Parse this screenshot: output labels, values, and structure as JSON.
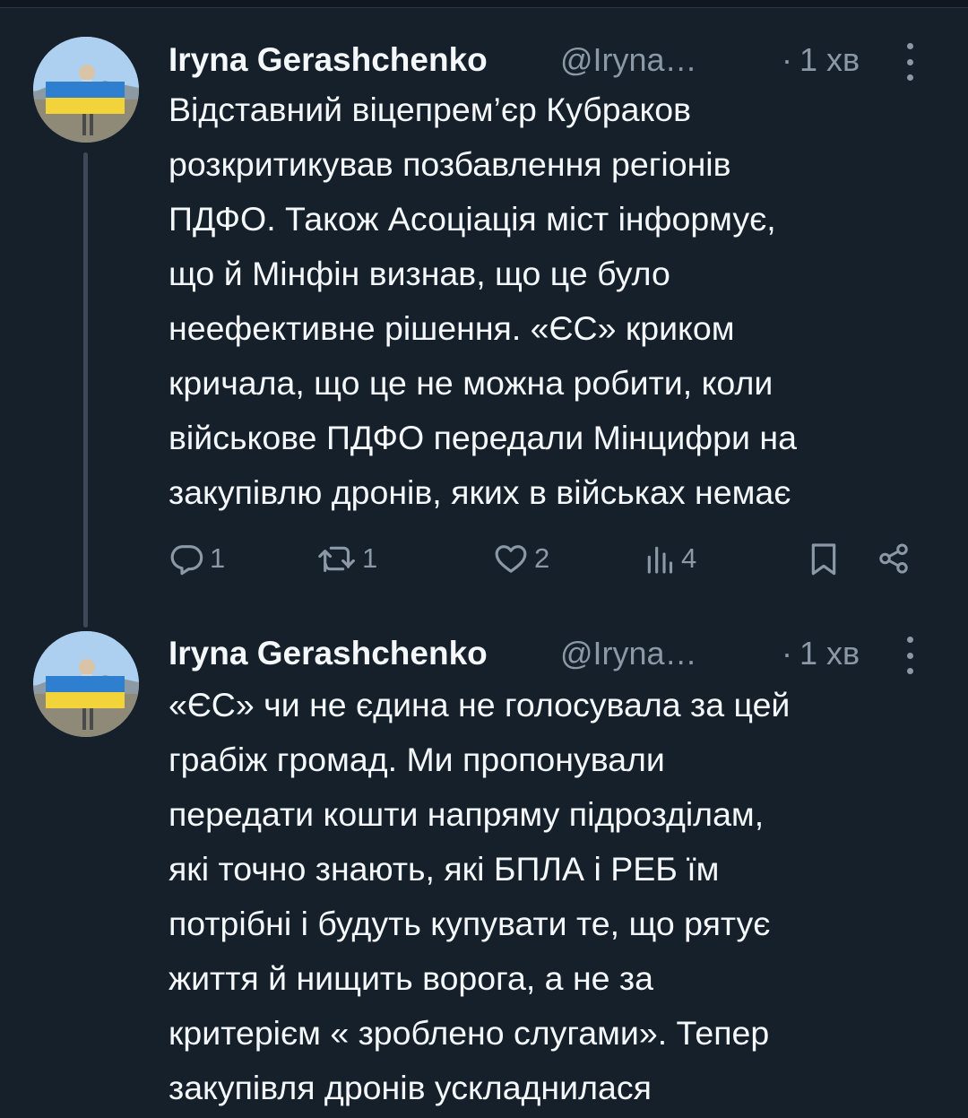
{
  "tweets": [
    {
      "author": "Iryna Gerashchenko",
      "handle": "@Iryna…",
      "dot": "·",
      "time": "1 хв",
      "lines": [
        "Відставний віцепрем’єр Кубраков",
        "розкритикував позбавлення регіонів",
        "ПДФО. Також Асоціація міст інформує,",
        "що й Мінфін визнав, що це було",
        "неефективне рішення. «ЄС» криком",
        "кричала, що це не можна робити, коли",
        "військове ПДФО передали Мінцифри на",
        "закупівлю дронів, яких в військах немає"
      ],
      "replies": "1",
      "retweets": "1",
      "likes": "2",
      "views": "4"
    },
    {
      "author": "Iryna Gerashchenko",
      "handle": "@Iryna…",
      "dot": "·",
      "time": "1 хв",
      "lines": [
        "«ЄС» чи не єдина не голосувала за цей",
        "грабіж громад.  Ми пропонували",
        "передати кошти напряму підрозділам,",
        "які точно знають, які БПЛА і РЕБ їм",
        "потрібні і будуть купувати те, що рятує",
        "життя й нищить ворога, а не за",
        "критерієм « зроблено слугами». Тепер",
        "закупівля  дронів  ускладнилася"
      ]
    }
  ],
  "icons": {
    "avatar": "avatar-photo-ukrainian-flag",
    "more": "more-vertical-icon",
    "reply": "reply-icon",
    "retweet": "retweet-icon",
    "like": "heart-icon",
    "views": "views-chart-icon",
    "bookmark": "bookmark-icon",
    "share": "share-icon"
  },
  "colors": {
    "background": "#15202b",
    "text": "#f5f8fa",
    "secondary": "#8b98a5",
    "thread_line": "#3d4a56"
  }
}
